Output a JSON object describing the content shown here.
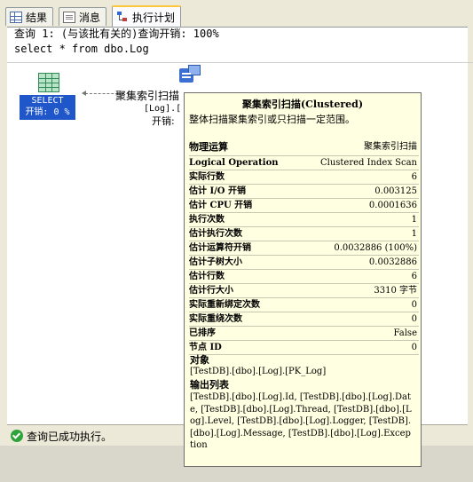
{
  "tabs": [
    {
      "label": "结果",
      "icon": "grid-icon"
    },
    {
      "label": "消息",
      "icon": "message-icon"
    },
    {
      "label": "执行计划",
      "icon": "execution-plan-icon"
    }
  ],
  "query": {
    "header": "查询 1: (与该批有关的)查询开销: 100%",
    "sql": "select * from dbo.Log"
  },
  "plan": {
    "select_node": {
      "label": "SELECT",
      "cost": "开销: 0 %"
    },
    "scan_node": {
      "label": "聚集索引扫描",
      "object_short": "[Log].[",
      "cost_short": "开销:"
    }
  },
  "tooltip": {
    "title": "聚集索引扫描(Clustered)",
    "description": "整体扫描聚集索引或只扫描一定范围。",
    "rows": [
      {
        "key": "物理运算",
        "value": "聚集索引扫描"
      },
      {
        "key": "Logical Operation",
        "value": "Clustered Index Scan"
      },
      {
        "key": "实际行数",
        "value": "6"
      },
      {
        "key": "估计 I/O 开销",
        "value": "0.003125"
      },
      {
        "key": "估计 CPU 开销",
        "value": "0.0001636"
      },
      {
        "key": "执行次数",
        "value": "1"
      },
      {
        "key": "估计执行次数",
        "value": "1"
      },
      {
        "key": "估计运算符开销",
        "value": "0.0032886 (100%)"
      },
      {
        "key": "估计子树大小",
        "value": "0.0032886"
      },
      {
        "key": "估计行数",
        "value": "6"
      },
      {
        "key": "估计行大小",
        "value": "3310 字节"
      },
      {
        "key": "实际重新绑定次数",
        "value": "0"
      },
      {
        "key": "实际重绕次数",
        "value": "0"
      },
      {
        "key": "已排序",
        "value": "False"
      },
      {
        "key": "节点 ID",
        "value": "0"
      }
    ],
    "object_heading": "对象",
    "object_value": "[TestDB].[dbo].[Log].[PK_Log]",
    "output_heading": "输出列表",
    "output_value": "[TestDB].[dbo].[Log].Id, [TestDB].[dbo].[Log].Date, [TestDB].[dbo].[Log].Thread, [TestDB].[dbo].[Log].Level, [TestDB].[dbo].[Log].Logger, [TestDB].[dbo].[Log].Message, [TestDB].[dbo].[Log].Exception"
  },
  "status": {
    "text": "查询已成功执行。",
    "icon": "success-check-icon"
  }
}
